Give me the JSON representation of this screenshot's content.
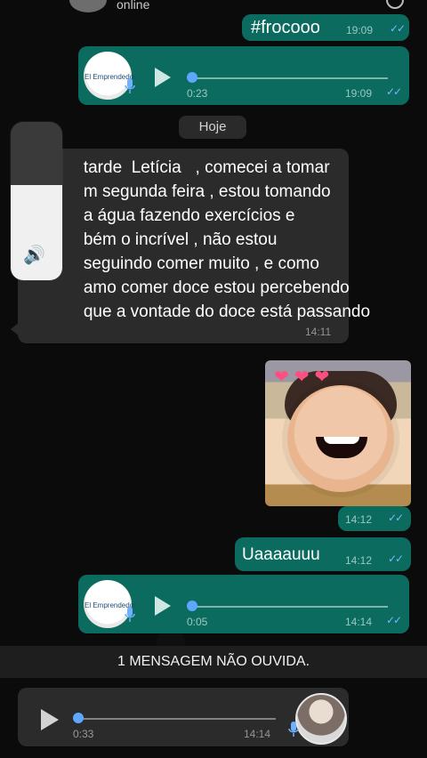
{
  "header": {
    "status": "online"
  },
  "messages": {
    "m1": {
      "text": "#frocooo",
      "time": "19:09"
    },
    "m2": {
      "thumb_text": "El Emprendedor",
      "duration": "0:23",
      "time": "19:09"
    },
    "date": "Hoje",
    "m3": {
      "text": "   tarde  Letícia   , comecei a tomar\n   m segunda feira , estou tomando\n   a água fazendo exercícios e\n   bém o incrível , não estou\n   seguindo comer muito , e como\n   amo comer doce estou percebendo\n   que a vontade do doce está passando",
      "time": "14:11"
    },
    "m4": {
      "time": "14:12"
    },
    "m5": {
      "text": "Uaaaauuu",
      "time": "14:12"
    },
    "m6": {
      "thumb_text": "El Emprendedor",
      "duration": "0:05",
      "time": "14:14"
    },
    "unread": "1 MENSAGEM NÃO OUVIDA.",
    "m7": {
      "duration": "0:33",
      "time": "14:14"
    }
  },
  "ui": {
    "colors": {
      "background": "#0b0b0b",
      "outgoing_bubble": "#0c6b5f",
      "incoming_bubble": "#2b2b2b",
      "accent_blue": "#5da7ff"
    },
    "icons": {
      "play": "play-icon",
      "mic": "mic-icon",
      "ticks": "double-check-icon",
      "speaker": "speaker-icon"
    }
  }
}
